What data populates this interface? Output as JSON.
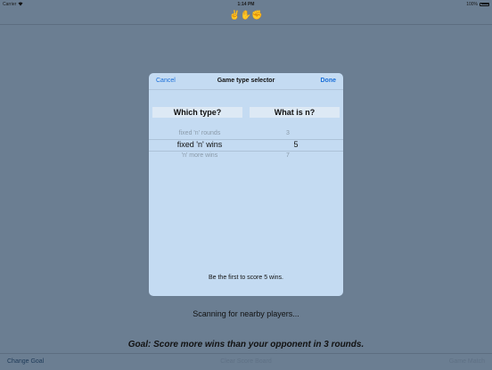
{
  "status_bar": {
    "carrier": "Carrier",
    "time": "1:14 PM",
    "battery": "100%"
  },
  "nav": {
    "title": "✌✋✊"
  },
  "modal": {
    "cancel_label": "Cancel",
    "title": "Game type selector",
    "done_label": "Done",
    "type_column_header": "Which type?",
    "n_column_header": "What is n?",
    "type_picker": {
      "above": "fixed 'n' rounds",
      "selected": "fixed 'n' wins",
      "below": "'n' more wins"
    },
    "n_picker": {
      "above": "3",
      "selected": "5",
      "below": "7"
    },
    "footer_text": "Be the first to score 5 wins."
  },
  "main": {
    "scanning_text": "Scanning for nearby players...",
    "goal_text": "Goal: Score more wins than your opponent in 3 rounds."
  },
  "toolbar": {
    "change_goal_label": "Change Goal",
    "clear_score_label": "Clear Score Board",
    "game_match_label": "Game Match"
  }
}
